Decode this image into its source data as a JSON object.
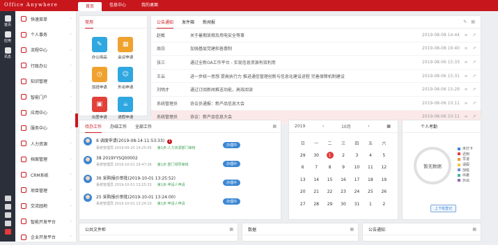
{
  "header": {
    "brand": "Office Anywhere",
    "tabs": [
      "首页",
      "信息中心",
      "我的桌面"
    ]
  },
  "rail": [
    {
      "label": "首页"
    },
    {
      "label": "应用"
    },
    {
      "label": "讯息"
    }
  ],
  "sidebar": {
    "items": [
      {
        "label": "快速菜单"
      },
      {
        "label": "个人事务"
      },
      {
        "label": "流程中心"
      },
      {
        "label": "行政办公"
      },
      {
        "label": "知识管理"
      },
      {
        "label": "智能门户"
      },
      {
        "label": "应用中心"
      },
      {
        "label": "服务中心"
      },
      {
        "label": "人力资源"
      },
      {
        "label": "档案管理"
      },
      {
        "label": "CRM系统"
      },
      {
        "label": "项目管理"
      },
      {
        "label": "交流园地"
      },
      {
        "label": "智能开发平台"
      },
      {
        "label": "企业开发平台"
      }
    ]
  },
  "apps_panel": {
    "title": "常用",
    "apps": [
      {
        "label": "办公用品",
        "color": "#2fa7e0",
        "icon": "pencil-icon"
      },
      {
        "label": "会议申请",
        "color": "#f0a22e",
        "icon": "chart-icon"
      },
      {
        "label": "加班申请",
        "color": "#f0a22e",
        "icon": "clock-icon"
      },
      {
        "label": "外出申请",
        "color": "#2fa7e0",
        "icon": "person-icon"
      },
      {
        "label": "出差申请",
        "color": "#e2413a",
        "icon": "bag-icon"
      },
      {
        "label": "请假申请",
        "color": "#2fa7e0",
        "icon": "cup-icon"
      }
    ]
  },
  "news_panel": {
    "tabs": [
      "公告通知",
      "发件箱",
      "新闻报"
    ],
    "rows": [
      {
        "who": "赵敏",
        "title": "关于暑期放假及用电安全等事",
        "date": "2019-08-08 14:44"
      },
      {
        "who": "周白",
        "title": "加强基层党建和普惠制",
        "date": "2019-08-08 16:40"
      },
      {
        "who": "张三",
        "title": "通过全新OA工作平台 - 实现信息资源有效利用",
        "date": "2019-08-06 15:33"
      },
      {
        "who": "王云",
        "title": "进一步统一思想 提高执行力 推进通信管理创新与信息化建设进程 完善保障机制建设",
        "date": "2019-08-06 15:31"
      },
      {
        "who": "刘明才",
        "title": "通过订阅新闻推送功能，高效阅读",
        "date": "2019-08-06 15:29"
      },
      {
        "who": "系统管理员",
        "title": "协议员通报：新产品信息大会",
        "date": "2019-08-06 10:11"
      },
      {
        "who": "系统管理员",
        "title": "协议：新产品信息大会",
        "date": "2019-08-06 10:11"
      }
    ]
  },
  "tasks_panel": {
    "tabs": [
      "待办工作",
      "办结工作",
      "全部工作"
    ],
    "rows": [
      {
        "title": "8  调度申请(2019-08-14 11:53:33)",
        "sub1": "系统管理员  2019-09-20 14:25:05",
        "step": "第1步:人力资源部门审核",
        "badge": "1",
        "btn": "办理中"
      },
      {
        "title": "38  2019YYSQ00002",
        "sub1": "系统管理员  2019-10-01 19:47:26",
        "step": "第1步:部门领导审核",
        "badge": "",
        "btn": "办理中"
      },
      {
        "title": "36  采购报价审批(2019-10-01 13:25:52)",
        "sub1": "系统管理员  2019-10-01 13:25:33",
        "step": "第1步:申请人申请",
        "badge": "",
        "btn": "办理中"
      },
      {
        "title": "25  采购报价审批(2019-10-01 13:24:00)",
        "sub1": "系统管理员  2019-10-01 13:24:10",
        "step": "第1步:申请人申请",
        "badge": "",
        "btn": "办理中"
      }
    ]
  },
  "calendar": {
    "year": "2019",
    "month": "10月",
    "weekdays": [
      "日",
      "一",
      "二",
      "三",
      "四",
      "五",
      "六"
    ],
    "days": [
      "29",
      "30",
      "1",
      "2",
      "3",
      "4",
      "5",
      "6",
      "7",
      "8",
      "9",
      "10",
      "11",
      "12",
      "13",
      "14",
      "15",
      "16",
      "17",
      "18",
      "19",
      "20",
      "21",
      "22",
      "23",
      "24",
      "25",
      "26",
      "27",
      "28",
      "29",
      "30",
      "31",
      "1",
      "2"
    ],
    "today": "1"
  },
  "attendance": {
    "title": "个人考勤",
    "center": "暂无数据",
    "legend": [
      {
        "label": "未打卡",
        "color": "#3b87d4"
      },
      {
        "label": "迟到",
        "color": "#e23a3a"
      },
      {
        "label": "早退",
        "color": "#e89a35"
      },
      {
        "label": "请假",
        "color": "#f3c840"
      },
      {
        "label": "加班",
        "color": "#6f8ad6"
      },
      {
        "label": "出差",
        "color": "#46b59b"
      },
      {
        "label": "外出",
        "color": "#8a6bb4"
      }
    ],
    "btn": "上下班登记"
  },
  "bottom": {
    "left": "公共文件柜",
    "mid": "数据",
    "right": "公告通知"
  }
}
